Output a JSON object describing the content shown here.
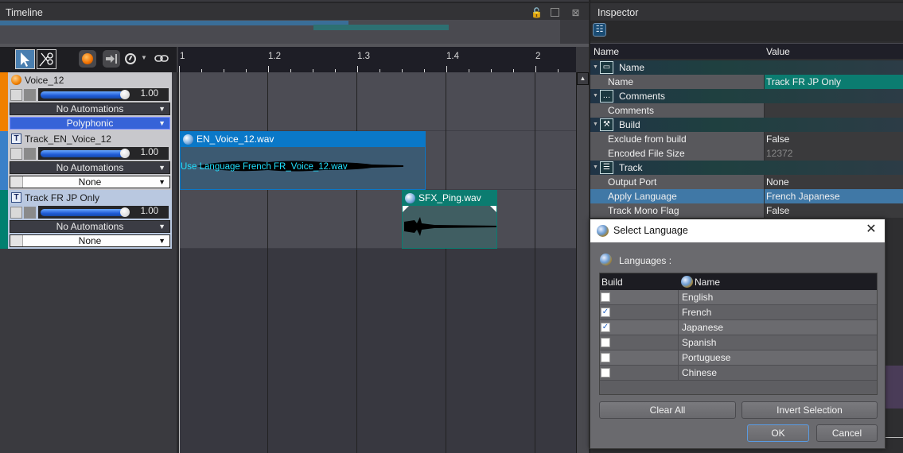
{
  "timeline": {
    "title": "Timeline",
    "window_icons": [
      "unlock-icon",
      "float-window-icon",
      "close-panel-icon"
    ],
    "toolbar": {
      "tools": [
        "select-tool",
        "cut-tool"
      ],
      "buttons": [
        "record-button",
        "snap-end-button",
        "timer-dropdown-button",
        "link-button"
      ]
    },
    "ruler": {
      "labels": [
        "1",
        "1.2",
        "1.3",
        "1.4",
        "2"
      ]
    },
    "tracks": [
      {
        "name": "Voice_12",
        "color": "#f08000",
        "volume": "1.00",
        "automation": "No Automations",
        "mode": "Polyphonic"
      },
      {
        "name": "Track_EN_Voice_12",
        "color": "#3a80c8",
        "volume": "1.00",
        "automation": "No Automations",
        "output": "None"
      },
      {
        "name": "Track FR JP Only",
        "color": "#008070",
        "volume": "1.00",
        "automation": "No Automations",
        "output": "None"
      }
    ],
    "clips": [
      {
        "title": "EN_Voice_12.wav",
        "overlay_text": "Use Language French FR_Voice_12.wav",
        "color": "#0a78c8"
      },
      {
        "title": "SFX_Ping.wav",
        "color": "#0b7c70"
      }
    ]
  },
  "inspector": {
    "title": "Inspector",
    "columns": {
      "name": "Name",
      "value": "Value"
    },
    "sections": [
      {
        "category": "Name",
        "rows": [
          {
            "name": "Name",
            "value": "Track FR JP Only"
          }
        ]
      },
      {
        "category": "Comments",
        "rows": [
          {
            "name": "Comments",
            "value": ""
          }
        ]
      },
      {
        "category": "Build",
        "rows": [
          {
            "name": "Exclude from build",
            "value": "False"
          },
          {
            "name": "Encoded File Size",
            "value": "12372"
          }
        ]
      },
      {
        "category": "Track",
        "rows": [
          {
            "name": "Output Port",
            "value": "None"
          },
          {
            "name": "Apply Language",
            "value": "French Japanese"
          },
          {
            "name": "Track Mono Flag",
            "value": "False"
          }
        ]
      }
    ]
  },
  "dialog": {
    "title": "Select Language",
    "label": "Languages :",
    "columns": {
      "build": "Build",
      "name": "Name"
    },
    "languages": [
      {
        "name": "English",
        "checked": false
      },
      {
        "name": "French",
        "checked": true
      },
      {
        "name": "Japanese",
        "checked": true
      },
      {
        "name": "Spanish",
        "checked": false
      },
      {
        "name": "Portuguese",
        "checked": false
      },
      {
        "name": "Chinese",
        "checked": false
      }
    ],
    "buttons": {
      "clear_all": "Clear All",
      "invert": "Invert Selection",
      "ok": "OK",
      "cancel": "Cancel"
    }
  }
}
